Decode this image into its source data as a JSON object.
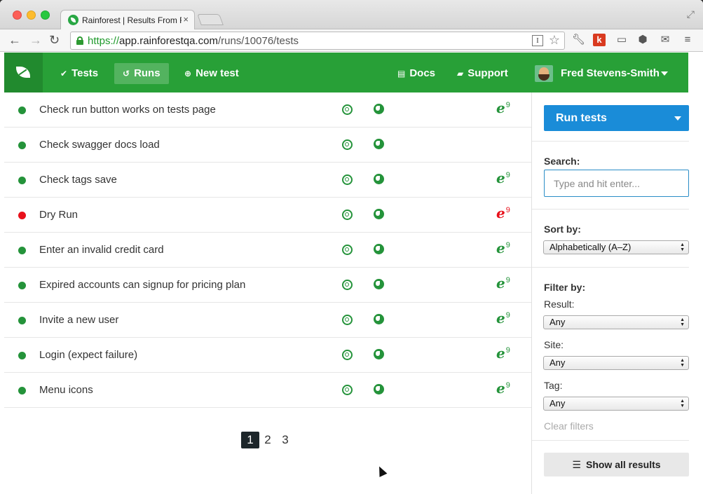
{
  "browser": {
    "tab_title": "Rainforest | Results From R",
    "tab_close": "×",
    "url_scheme": "https://",
    "url_host": "app.rainforestqa.com",
    "url_path": "/runs/10076/tests",
    "reader_label": "I",
    "ext_k_label": "k"
  },
  "nav": {
    "tests": "Tests",
    "runs": "Runs",
    "new_test": "New test",
    "docs": "Docs",
    "support": "Support",
    "user_name": "Fred Stevens-Smith"
  },
  "tests": [
    {
      "name": "Check run button works on tests page",
      "status": "passed",
      "ie": true,
      "ie_status": "passed"
    },
    {
      "name": "Check swagger docs load",
      "status": "passed",
      "ie": false,
      "ie_status": ""
    },
    {
      "name": "Check tags save",
      "status": "passed",
      "ie": true,
      "ie_status": "passed"
    },
    {
      "name": "Dry Run",
      "status": "failed",
      "ie": true,
      "ie_status": "failed"
    },
    {
      "name": "Enter an invalid credit card",
      "status": "passed",
      "ie": true,
      "ie_status": "passed"
    },
    {
      "name": "Expired accounts can signup for pricing plan",
      "status": "passed",
      "ie": true,
      "ie_status": "passed"
    },
    {
      "name": "Invite a new user",
      "status": "passed",
      "ie": true,
      "ie_status": "passed"
    },
    {
      "name": "Login (expect failure)",
      "status": "passed",
      "ie": true,
      "ie_status": "passed"
    },
    {
      "name": "Menu icons",
      "status": "passed",
      "ie": true,
      "ie_status": "passed"
    }
  ],
  "ie_version": "9",
  "pagination": {
    "pages": [
      "1",
      "2",
      "3"
    ],
    "current": "1"
  },
  "sidebar": {
    "run_tests": "Run tests",
    "search_label": "Search:",
    "search_placeholder": "Type and hit enter...",
    "sort_label": "Sort by:",
    "sort_value": "Alphabetically (A–Z)",
    "filter_label": "Filter by:",
    "result_label": "Result:",
    "result_value": "Any",
    "site_label": "Site:",
    "site_value": "Any",
    "tag_label": "Tag:",
    "tag_value": "Any",
    "clear_filters": "Clear filters",
    "show_all": "Show all results"
  },
  "colors": {
    "brand_green": "#28a037",
    "pass_green": "#24933a",
    "fail_red": "#e8111b",
    "run_blue": "#1a8cd8"
  }
}
